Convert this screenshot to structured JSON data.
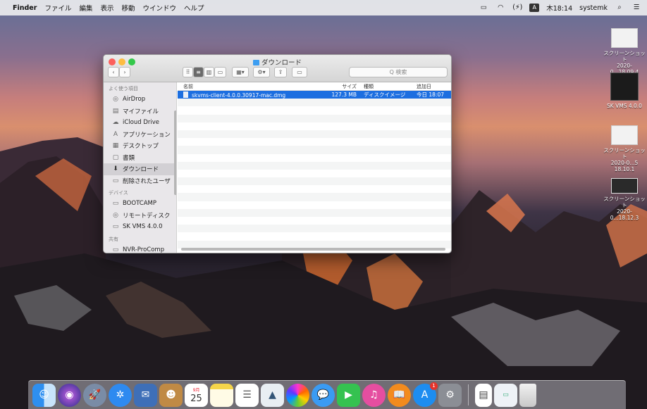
{
  "menubar": {
    "apple": "",
    "app": "Finder",
    "menus": [
      "ファイル",
      "編集",
      "表示",
      "移動",
      "ウインドウ",
      "ヘルプ"
    ],
    "clock": "木18:14",
    "user": "systemk"
  },
  "window": {
    "title": "ダウンロード",
    "search_placeholder": "Q 検索",
    "columns": {
      "name": "名前",
      "size": "サイズ",
      "kind": "種類",
      "date": "追加日"
    },
    "files": [
      {
        "name": "skvms-client-4.0.0.30917-mac.dmg",
        "size": "127.3 MB",
        "kind": "ディスクイメージ",
        "date": "今日 18:07"
      }
    ]
  },
  "sidebar": {
    "favorites_header": "よく使う項目",
    "favorites": [
      {
        "label": "AirDrop",
        "icon": "airdrop-icon"
      },
      {
        "label": "マイファイル",
        "icon": "my-files-icon"
      },
      {
        "label": "iCloud Drive",
        "icon": "cloud-icon"
      },
      {
        "label": "アプリケーション",
        "icon": "applications-icon"
      },
      {
        "label": "デスクトップ",
        "icon": "desktop-icon"
      },
      {
        "label": "書類",
        "icon": "documents-icon"
      },
      {
        "label": "ダウンロード",
        "icon": "downloads-icon"
      },
      {
        "label": "削除されたユーザ",
        "icon": "folder-icon"
      }
    ],
    "devices_header": "デバイス",
    "devices": [
      {
        "label": "BOOTCAMP",
        "icon": "disk-icon"
      },
      {
        "label": "リモートディスク",
        "icon": "remote-disc-icon"
      },
      {
        "label": "SK VMS 4.0.0",
        "icon": "disk-image-icon"
      }
    ],
    "shared_header": "共有",
    "shared": [
      {
        "label": "NVR-ProComp",
        "icon": "network-computer-icon"
      }
    ]
  },
  "desktop": {
    "items": [
      {
        "line1": "スクリーンショット",
        "line2": "2020-0...18.09.4"
      },
      {
        "line1": "SK VMS 4.0.0",
        "line2": ""
      },
      {
        "line1": "スクリーンショット",
        "line2": "2020-0...5 18.10.1"
      },
      {
        "line1": "スクリーンショット",
        "line2": "2020-0...18.12.3"
      }
    ]
  },
  "dock": {
    "calendar_month": "9月",
    "calendar_day": "25",
    "appstore_badge": "1"
  }
}
